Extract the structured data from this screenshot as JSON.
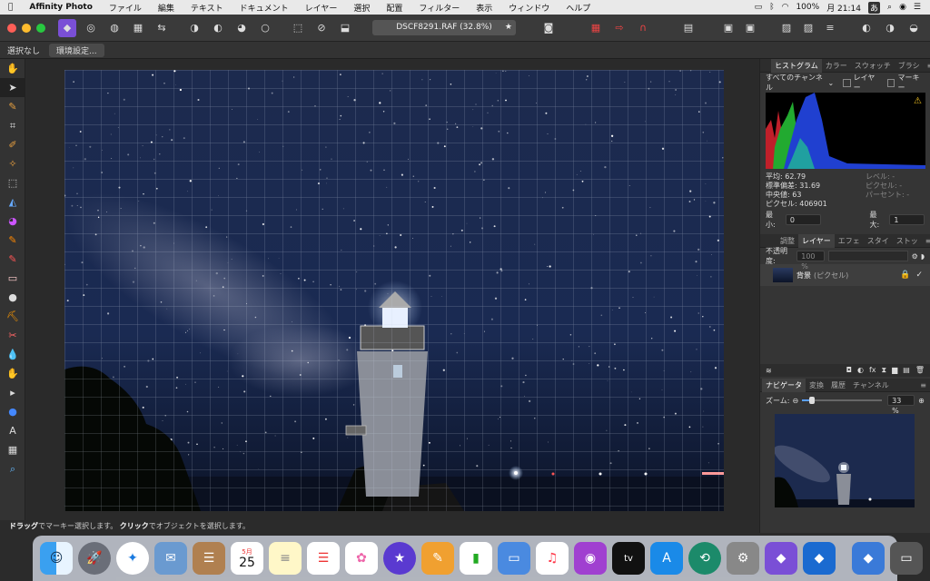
{
  "menubar": {
    "app_name": "Affinity Photo",
    "items": [
      "ファイル",
      "編集",
      "テキスト",
      "ドキュメント",
      "レイヤー",
      "選択",
      "配置",
      "フィルター",
      "表示",
      "ウィンドウ",
      "ヘルプ"
    ],
    "battery": "100%",
    "clock": "月 21:14",
    "input_method": "あ"
  },
  "toolbar": {
    "document_title": "DSCF8291.RAF (32.8%)"
  },
  "context": {
    "selection_label": "選択なし",
    "settings_button": "環境設定..."
  },
  "status": {
    "drag": "ドラッグ",
    "drag_desc": "でマーキー選択します。",
    "click": "クリック",
    "click_desc": "でオブジェクトを選択します。"
  },
  "histogram_panel": {
    "tabs": [
      "ヒストグラム",
      "カラー",
      "スウォッチ",
      "ブラシ"
    ],
    "channel": "すべてのチャンネル",
    "layer_opt": "レイヤー",
    "marquee_opt": "マーキー",
    "mean": "平均: 62.79",
    "std": "標準偏差: 31.69",
    "median": "中央値: 63",
    "pixels": "ピクセル: 406901",
    "level": "レベル: -",
    "pixel2": "ピクセル: -",
    "percent": "パーセント: -",
    "min_label": "最小:",
    "min_val": "0",
    "max_label": "最大:",
    "max_val": "1"
  },
  "layers_panel": {
    "tabs": [
      "調整",
      "レイヤー",
      "エフェ",
      "スタイ",
      "ストッ"
    ],
    "opacity_label": "不透明度:",
    "opacity_val": "100 %",
    "layer_name": "背景",
    "layer_type": "(ピクセル)"
  },
  "navigator_panel": {
    "tabs": [
      "ナビゲータ",
      "変換",
      "履歴",
      "チャンネル"
    ],
    "zoom_label": "ズーム:",
    "zoom_val": "33 %"
  },
  "dock": {
    "calendar_month": "5月",
    "calendar_day": "25",
    "apps": [
      "Finder",
      "Launchpad",
      "Safari",
      "Preview",
      "Contacts",
      "Calendar",
      "Notes",
      "Reminders",
      "Photos",
      "iMovie",
      "Pages",
      "Numbers",
      "Keynote",
      "Music",
      "Podcasts",
      "TV",
      "App Store",
      "Time Machine",
      "System Preferences",
      "Affinity Photo",
      "Affinity Designer",
      "Affinity Designer 2",
      "Screenshot",
      "Trash"
    ]
  },
  "colors": {
    "accent": "#7a4fd6",
    "panel_bg": "#353535",
    "sky": "#1a2540"
  }
}
